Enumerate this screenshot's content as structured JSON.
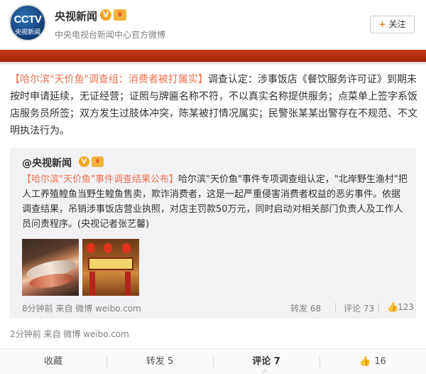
{
  "account": {
    "name": "央视新闻",
    "subtitle": "中央电视台新闻中心官方微博",
    "avatar_text": "CCTV",
    "avatar_subtext": "央视新闻",
    "verified_icon": "V",
    "vip_icon": "vip-crown-icon",
    "follow_label": "关注",
    "follow_plus": "+"
  },
  "post": {
    "title": "【哈尔滨\"天价鱼\"调查组：消费者被打属实】",
    "body": "调查认定：涉事饭店《餐饮服务许可证》到期未按时申请延续，无证经营；证照与牌匾名称不符，不以真实名称提供服务；点菜单上签字系饭店服务员所签；双方发生过肢体冲突，陈某被打情况属实；民警张某某出警存在不规范、不文明执法行为。",
    "time_source": "2分钟前 来自 微博 weibo.com"
  },
  "quoted": {
    "user": "@央视新闻",
    "title": "【哈尔滨\"天价鱼\"事件调查结果公布】",
    "body": "哈尔滨\"天价鱼\"事件专项调查组认定，\"北岸野生渔村\"把人工养殖鳇鱼当野生鳇鱼售卖，欺诈消费者，这是一起严重侵害消费者权益的恶劣事件。依据调查结果，吊销涉事饭店营业执照，对店主罚款50万元，同时启动对相关部门负责人及工作人员问责程序。(央视记者张艺馨)",
    "time_source": "8分钟前 来自 微博 weibo.com",
    "forward": "转发 68",
    "comment": "评论 73",
    "like": "123"
  },
  "actions": {
    "favorite": "收藏",
    "forward": "转发 5",
    "comment": "评论 7",
    "like": "16"
  },
  "colors": {
    "accent_link": "#eb7350",
    "red_banner": "#b22c10",
    "quote_bg": "#f2f2f5"
  }
}
